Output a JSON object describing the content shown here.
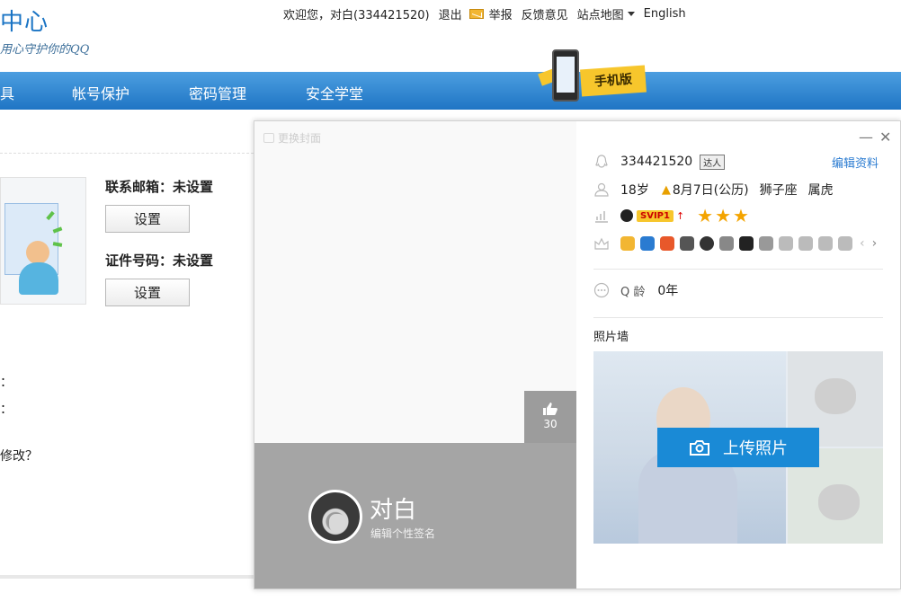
{
  "header": {
    "logo_title": "中心",
    "logo_slogan": "用心守护你的QQ",
    "welcome": "欢迎您，对白(334421520)",
    "logout": "退出",
    "report": "举报",
    "feedback": "反馈意见",
    "sitemap": "站点地图",
    "english": "English"
  },
  "nav": {
    "items": [
      "具",
      "帐号保护",
      "密码管理",
      "安全学堂"
    ],
    "mobile_label": "手机版"
  },
  "left": {
    "email_label": "联系邮箱：未设置",
    "id_label": "证件号码：未设置",
    "set_button_1": "设置",
    "set_button_2": "设置",
    "frag_1": "：",
    "frag_2": "：",
    "frag_3": "修改？"
  },
  "popup": {
    "change_cover": "更换封面",
    "likes": "30",
    "nickname": "对白",
    "signature": "编辑个性签名",
    "qq_number": "334421520",
    "daren": "达人",
    "edit_profile": "编辑资料",
    "age": "18岁",
    "birthday": "8月7日(公历)",
    "zodiac": "狮子座",
    "chinese_zodiac": "属虎",
    "vip": "SVIP1",
    "qage_label": "Q 龄",
    "qage_value": "0年",
    "photo_wall_title": "照片墙",
    "upload_photo": "上传照片",
    "minimize": "—",
    "close": "✕"
  },
  "colors": {
    "nav_blue": "#1f75c4",
    "link_blue": "#2a7bd1",
    "upload_blue": "#1a8ad6",
    "band_gray": "#a5a5a5"
  }
}
